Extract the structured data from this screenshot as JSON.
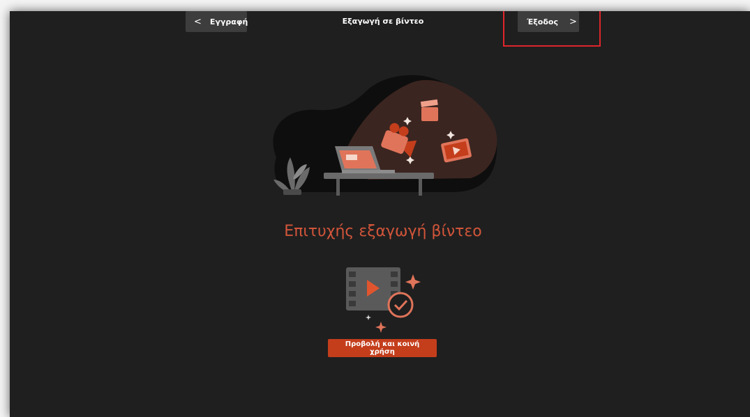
{
  "header": {
    "back_label": "Εγγραφή",
    "title": "Εξαγωγή σε βίντεο",
    "exit_label": "Έξοδος"
  },
  "main": {
    "success_message": "Επιτυχής εξαγωγή βίντεο",
    "primary_button_label": "Προβολή και κοινή χρήση"
  },
  "icons": {
    "back": "chevron-left-icon",
    "exit": "chevron-right-icon",
    "hero": "video-export-illustration",
    "status": "video-exported-check-icon"
  },
  "colors": {
    "background": "#1f1f1f",
    "accent": "#c43e1c",
    "accent_text": "#d2553a",
    "highlight": "#e0252b",
    "nav_button": "#3d3d3d"
  }
}
